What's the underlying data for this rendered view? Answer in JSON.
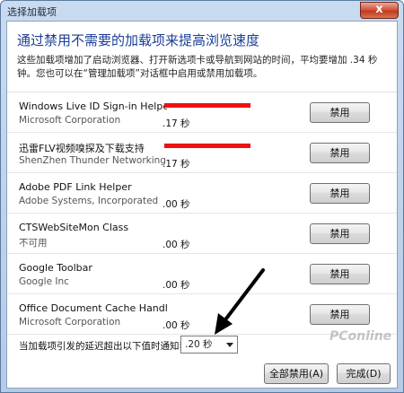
{
  "window": {
    "title": "选择加载项",
    "close_glyph": "x"
  },
  "heading": "通过禁用不需要的加载项来提高浏览速度",
  "description": "这些加载项增加了启动浏览器、打开新选项卡或导航到网站的时间，平均要增加 .34 秒钟。您也可以在“管理加载项”对话框中启用或禁用加载项。",
  "addons": [
    {
      "name": "Windows Live ID Sign-in Helper",
      "publisher": "Microsoft Corporation",
      "load_time": ".17 秒",
      "button": "禁用",
      "highlighted": true
    },
    {
      "name": "迅雷FLV视频嗅探及下载支持",
      "publisher": "ShenZhen Thunder Networking T",
      "load_time": ".17 秒",
      "button": "禁用",
      "highlighted": true
    },
    {
      "name": "Adobe PDF Link Helper",
      "publisher": "Adobe Systems, Incorporated",
      "load_time": ".00 秒",
      "button": "禁用",
      "highlighted": false
    },
    {
      "name": "CTSWebSiteMon Class",
      "publisher": "不可用",
      "load_time": ".00 秒",
      "button": "禁用",
      "highlighted": false
    },
    {
      "name": "Google Toolbar",
      "publisher": "Google Inc",
      "load_time": ".00 秒",
      "button": "禁用",
      "highlighted": false
    },
    {
      "name": "Office Document Cache Handler",
      "publisher": "Microsoft Corporation",
      "load_time": ".00 秒",
      "button": "禁用",
      "highlighted": false
    }
  ],
  "footer": {
    "notify_label": "当加载项引发的延迟超出以下值时通知我:",
    "threshold_value": ".20 秒",
    "disable_all_label": "全部禁用(A)",
    "done_label": "完成(D)"
  },
  "watermark": "PConline",
  "colors": {
    "heading": "#1a3e96",
    "highlight_bar": "#ee1111",
    "frame": "#b5cbe6"
  }
}
